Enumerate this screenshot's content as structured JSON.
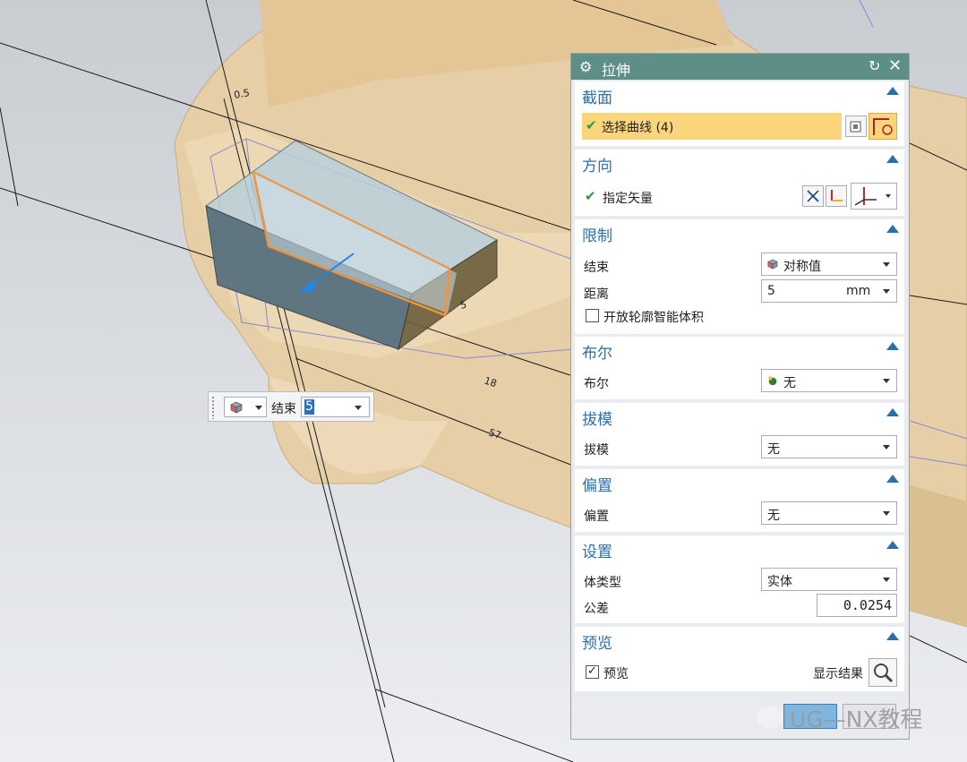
{
  "floating_toolbar": {
    "end_label": "结束",
    "end_value": "5"
  },
  "dialog": {
    "title": "拉伸",
    "section_section": {
      "header": "截面",
      "select_curve_label": "选择曲线 (4)"
    },
    "section_direction": {
      "header": "方向",
      "specify_vector_label": "指定矢量"
    },
    "section_limits": {
      "header": "限制",
      "end_label": "结束",
      "end_value": "对称值",
      "distance_label": "距离",
      "distance_value": "5",
      "distance_unit": "mm",
      "open_profile_label": "开放轮廓智能体积"
    },
    "section_boolean": {
      "header": "布尔",
      "boolean_label": "布尔",
      "boolean_value": "无"
    },
    "section_draft": {
      "header": "拔模",
      "draft_label": "拔模",
      "draft_value": "无"
    },
    "section_offset": {
      "header": "偏置",
      "offset_label": "偏置",
      "offset_value": "无"
    },
    "section_settings": {
      "header": "设置",
      "body_type_label": "体类型",
      "body_type_value": "实体",
      "tolerance_label": "公差",
      "tolerance_value": "0.0254"
    },
    "section_preview": {
      "header": "预览",
      "preview_label": "预览",
      "show_result_label": "显示结果"
    }
  },
  "viewport": {
    "dim_labels": [
      "0.5",
      "5",
      "18",
      "57"
    ]
  },
  "watermark": "UG—NX教程",
  "colors": {
    "title_bar": "#5d8f86",
    "section_header": "#2c6fa8",
    "highlight": "#fbd57c",
    "model_tan": "#e4c9a0",
    "preview_orange": "#f0943a"
  }
}
